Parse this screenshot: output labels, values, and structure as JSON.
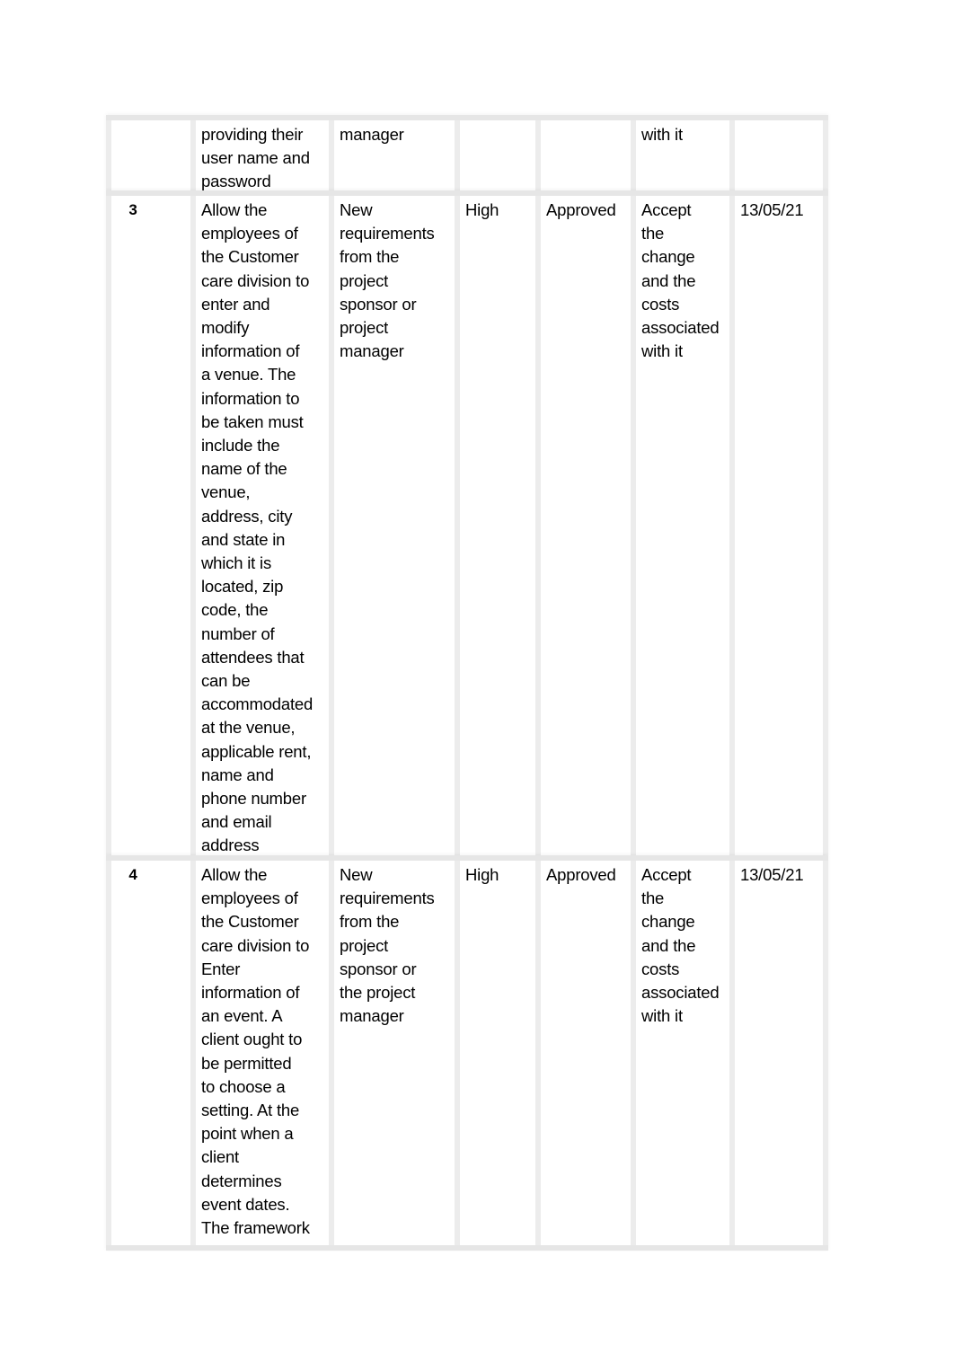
{
  "rows": [
    {
      "no": "",
      "requirement": "providing their\nuser name and\npassword",
      "source": "manager",
      "priority": "",
      "status": "",
      "action": "with it",
      "date": ""
    },
    {
      "no": "3",
      "requirement": "Allow the\nemployees of\nthe Customer\ncare division to\nenter and\nmodify\ninformation of\na venue. The\ninformation to\nbe taken must\ninclude the\nname of the\nvenue,\naddress, city\nand state in\nwhich it is\nlocated, zip\ncode, the\nnumber of\nattendees that\ncan be\naccommodated\nat the venue,\napplicable rent,\nname and\nphone number\nand email\naddress",
      "source": "New\nrequirements\nfrom the\nproject\nsponsor or\nproject\nmanager",
      "priority": "High",
      "status": "Approved",
      "action": "Accept\nthe\nchange\nand the\ncosts\nassociated\nwith it",
      "date": "13/05/21"
    },
    {
      "no": "4",
      "requirement": "Allow the\nemployees of\nthe Customer\ncare division to\nEnter\ninformation of\nan event. A\nclient ought to\nbe permitted\nto choose a\nsetting. At the\npoint when a\nclient\ndetermines\nevent dates.\nThe framework",
      "source": "New\nrequirements\nfrom the\nproject\nsponsor or\nthe project\nmanager",
      "priority": "High",
      "status": "Approved",
      "action": "Accept\nthe\nchange\nand the\ncosts\nassociated\nwith it",
      "date": "13/05/21"
    }
  ]
}
